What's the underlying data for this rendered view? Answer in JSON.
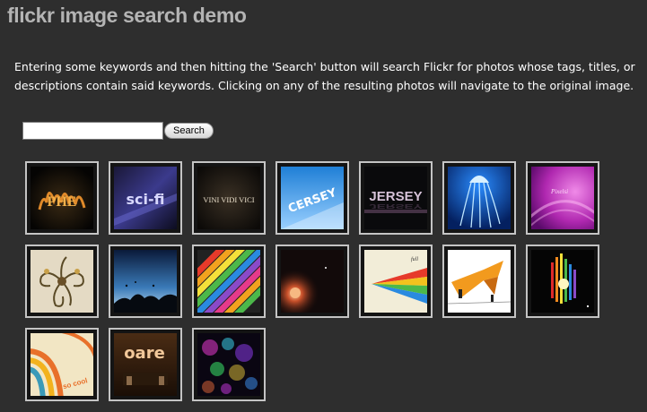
{
  "header": {
    "title": "flickr image search demo"
  },
  "intro": {
    "text": "Entering some keywords and then hitting the 'Search' button will search Flickr for photos whose tags, titles, or descriptions contain said keywords. Clicking on any of the resulting photos will navigate to the original image."
  },
  "search": {
    "value": "",
    "placeholder": "",
    "button_label": "Search"
  },
  "results": [
    {
      "icon": "fire-text-artwork-icon",
      "caption": "PHE"
    },
    {
      "icon": "sci-fi-text-artwork-icon",
      "caption": "sci-fi"
    },
    {
      "icon": "vini-vidi-vici-artwork-icon",
      "caption": "VINI VIDI VICI"
    },
    {
      "icon": "blue-3d-text-artwork-icon",
      "caption": "CERSEY"
    },
    {
      "icon": "jersey-chrome-text-artwork-icon",
      "caption": "JERSEY"
    },
    {
      "icon": "jellyfish-artwork-icon",
      "caption": ""
    },
    {
      "icon": "purple-swirl-artwork-icon",
      "caption": "Pixelsi"
    },
    {
      "icon": "floral-ornament-artwork-icon",
      "caption": ""
    },
    {
      "icon": "sunset-silhouette-artwork-icon",
      "caption": ""
    },
    {
      "icon": "diagonal-stripes-artwork-icon",
      "caption": ""
    },
    {
      "icon": "planet-burst-artwork-icon",
      "caption": ""
    },
    {
      "icon": "rainbow-arrow-artwork-icon",
      "caption": ""
    },
    {
      "icon": "orange-arrow-artwork-icon",
      "caption": ""
    },
    {
      "icon": "light-spectrum-artwork-icon",
      "caption": ""
    },
    {
      "icon": "retro-stripes-artwork-icon",
      "caption": ""
    },
    {
      "icon": "3d-letters-artwork-icon",
      "caption": "oare"
    },
    {
      "icon": "bokeh-lights-artwork-icon",
      "caption": ""
    }
  ],
  "colors": {
    "background": "#2e2e2e",
    "title": "#b4b4b4",
    "tile_border": "#c4c4c4"
  }
}
